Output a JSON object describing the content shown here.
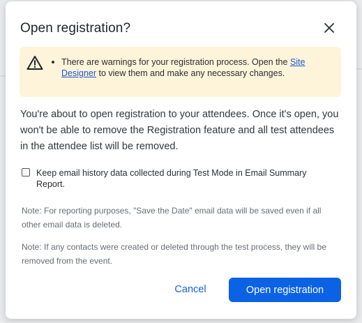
{
  "dialog": {
    "title": "Open registration?",
    "close_icon": "close-icon"
  },
  "warning": {
    "icon": "warning-triangle-icon",
    "text_before": "There are warnings for your registration process. Open the ",
    "link_text": "Site Designer",
    "text_after": " to view them and make any necessary changes."
  },
  "body": {
    "message": "You're about to open registration to your attendees. Once it's open, you won't be able to remove the Registration feature and all test attendees in the attendee list will be removed."
  },
  "checkbox": {
    "checked": false,
    "label": "Keep email history data collected during Test Mode in Email Summary Report."
  },
  "notes": [
    "Note: For reporting purposes, \"Save the Date\" email data will be saved even if all other email data is deleted.",
    "Note: If any contacts were created or deleted through the test process, they will be removed from the event."
  ],
  "actions": {
    "cancel_label": "Cancel",
    "confirm_label": "Open registration"
  },
  "colors": {
    "primary": "#0b62e4",
    "link": "#1d55d6",
    "warning_bg": "#fdf4d9"
  }
}
